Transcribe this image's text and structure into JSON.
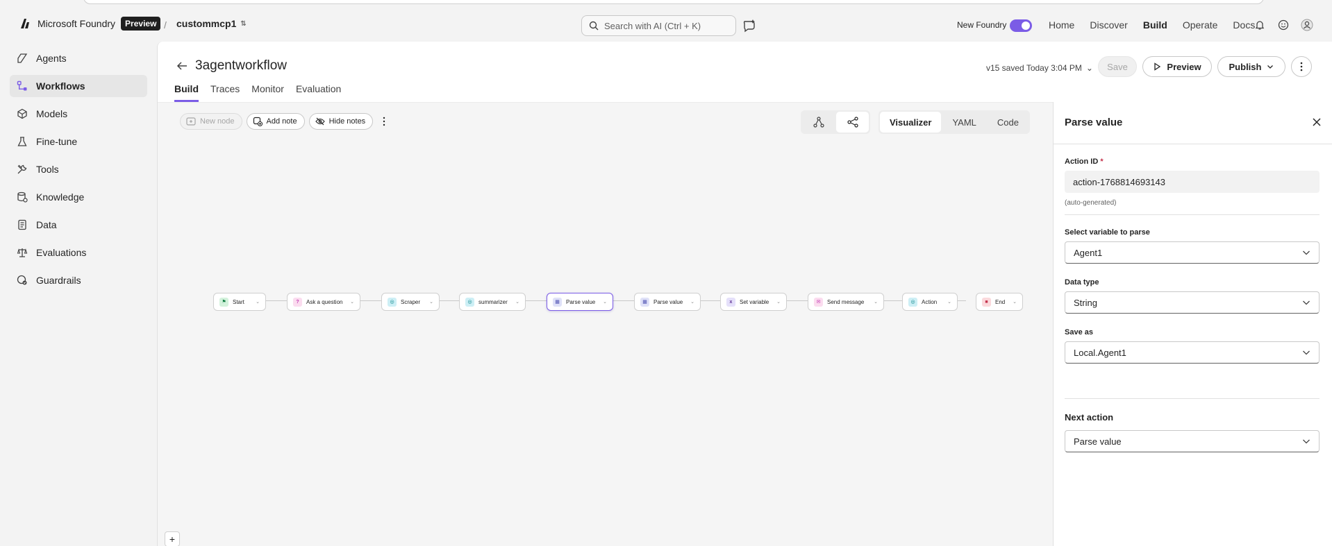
{
  "header": {
    "brand": "Microsoft Foundry",
    "badge": "Preview",
    "separator": "/",
    "project": "custommcp1",
    "search_placeholder": "Search with AI (Ctrl + K)",
    "new_foundry_label": "New Foundry",
    "new_foundry_on": true,
    "nav": [
      "Home",
      "Discover",
      "Build",
      "Operate",
      "Docs"
    ],
    "active_nav": "Build"
  },
  "sidebar": {
    "items": [
      {
        "label": "Agents",
        "icon": "agents-icon"
      },
      {
        "label": "Workflows",
        "icon": "workflows-icon",
        "active": true
      },
      {
        "label": "Models",
        "icon": "models-icon"
      },
      {
        "label": "Fine-tune",
        "icon": "flask-icon"
      },
      {
        "label": "Tools",
        "icon": "tools-icon"
      },
      {
        "label": "Knowledge",
        "icon": "database-icon"
      },
      {
        "label": "Data",
        "icon": "document-icon"
      },
      {
        "label": "Evaluations",
        "icon": "scale-icon"
      },
      {
        "label": "Guardrails",
        "icon": "guardrails-icon"
      }
    ]
  },
  "workflow": {
    "title": "3agentworkflow",
    "tabs": [
      "Build",
      "Traces",
      "Monitor",
      "Evaluation"
    ],
    "active_tab": "Build",
    "saved_status": "v15 saved Today 3:04 PM",
    "save_label": "Save",
    "preview_label": "Preview",
    "publish_label": "Publish"
  },
  "canvas": {
    "tools": {
      "new_node": "New node",
      "add_note": "Add note",
      "hide_notes": "Hide notes"
    },
    "views": [
      "Visualizer",
      "YAML",
      "Code"
    ],
    "active_view": "Visualizer",
    "nodes": [
      {
        "label": "Start",
        "icon_bg": "#d3f2dc",
        "icon_fg": "#107c41",
        "glyph": "⚑"
      },
      {
        "label": "Ask a question",
        "icon_bg": "#fbdcef",
        "icon_fg": "#c239b3",
        "glyph": "?"
      },
      {
        "label": "Scraper",
        "icon_bg": "#cdeff5",
        "icon_fg": "#038387",
        "glyph": "◎"
      },
      {
        "label": "summarizer",
        "icon_bg": "#cdeff5",
        "icon_fg": "#038387",
        "glyph": "◎"
      },
      {
        "label": "Parse value",
        "icon_bg": "#dfe1f8",
        "icon_fg": "#4f52b2",
        "glyph": "▦",
        "selected": true
      },
      {
        "label": "Parse value",
        "icon_bg": "#dfe1f8",
        "icon_fg": "#4f52b2",
        "glyph": "▦"
      },
      {
        "label": "Set variable",
        "icon_bg": "#e5e0fa",
        "icon_fg": "#5c2e91",
        "glyph": "x"
      },
      {
        "label": "Send message",
        "icon_bg": "#fbdcef",
        "icon_fg": "#c239b3",
        "glyph": "✉"
      },
      {
        "label": "Action",
        "icon_bg": "#cdeff5",
        "icon_fg": "#038387",
        "glyph": "◎"
      },
      {
        "label": "End",
        "icon_bg": "#fbd9dc",
        "icon_fg": "#c4314b",
        "glyph": "■"
      }
    ]
  },
  "panel": {
    "title": "Parse value",
    "action_id_label": "Action ID",
    "required_mark": "*",
    "action_id_value": "action-1768814693143",
    "action_id_hint": "(auto-generated)",
    "variable_label": "Select variable to parse",
    "variable_value": "Agent1",
    "datatype_label": "Data type",
    "datatype_value": "String",
    "saveas_label": "Save as",
    "saveas_value": "Local.Agent1",
    "next_action_title": "Next action",
    "next_action_value": "Parse value"
  },
  "colors": {
    "accent": "#7b5ce6",
    "selected_node_border": "#7b5ce6"
  }
}
